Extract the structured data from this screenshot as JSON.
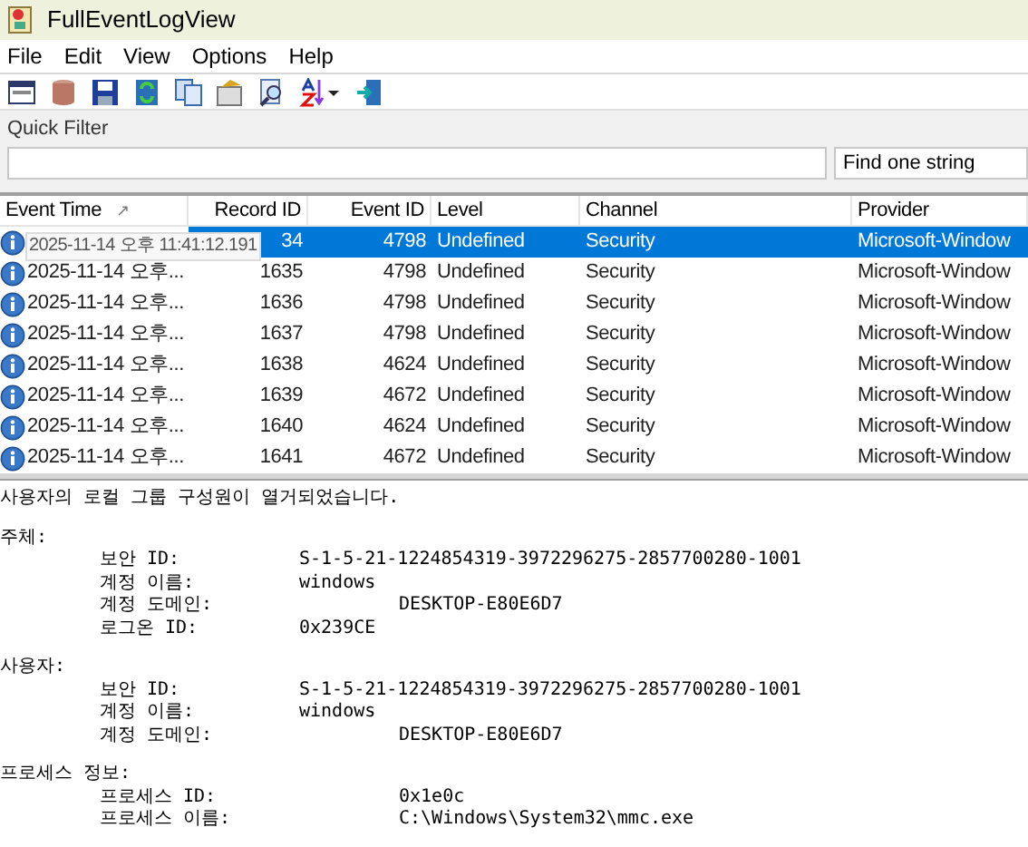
{
  "window": {
    "title": "FullEventLogView"
  },
  "menu": [
    "File",
    "Edit",
    "View",
    "Options",
    "Help"
  ],
  "quick_filter": {
    "label": "Quick Filter",
    "mode": "Find one string"
  },
  "table": {
    "columns": [
      {
        "label": "Event Time",
        "sort": "↗"
      },
      {
        "label": "Record ID"
      },
      {
        "label": "Event ID"
      },
      {
        "label": "Level"
      },
      {
        "label": "Channel"
      },
      {
        "label": "Provider"
      }
    ],
    "rows": [
      {
        "selected": true,
        "record_id": "34",
        "event_id": "4798",
        "level": "Undefined",
        "channel": "Security",
        "provider": "Microsoft-Window"
      },
      {
        "selected": false,
        "event_time": "2025-11-14 오후...",
        "record_id": "1635",
        "event_id": "4798",
        "level": "Undefined",
        "channel": "Security",
        "provider": "Microsoft-Window"
      },
      {
        "selected": false,
        "event_time": "2025-11-14 오후...",
        "record_id": "1636",
        "event_id": "4798",
        "level": "Undefined",
        "channel": "Security",
        "provider": "Microsoft-Window"
      },
      {
        "selected": false,
        "event_time": "2025-11-14 오후...",
        "record_id": "1637",
        "event_id": "4798",
        "level": "Undefined",
        "channel": "Security",
        "provider": "Microsoft-Window"
      },
      {
        "selected": false,
        "event_time": "2025-11-14 오후...",
        "record_id": "1638",
        "event_id": "4624",
        "level": "Undefined",
        "channel": "Security",
        "provider": "Microsoft-Window"
      },
      {
        "selected": false,
        "event_time": "2025-11-14 오후...",
        "record_id": "1639",
        "event_id": "4672",
        "level": "Undefined",
        "channel": "Security",
        "provider": "Microsoft-Window"
      },
      {
        "selected": false,
        "event_time": "2025-11-14 오후...",
        "record_id": "1640",
        "event_id": "4624",
        "level": "Undefined",
        "channel": "Security",
        "provider": "Microsoft-Window"
      },
      {
        "selected": false,
        "event_time": "2025-11-14 오후...",
        "record_id": "1641",
        "event_id": "4672",
        "level": "Undefined",
        "channel": "Security",
        "provider": "Microsoft-Window"
      }
    ]
  },
  "tooltip": "2025-11-14 오후 11:41:12.191",
  "details": {
    "summary": "사용자의 로컬 그룹 구성원이 열거되었습니다.",
    "sections": [
      {
        "heading": "주체:",
        "fields": [
          {
            "label": "보안 ID:",
            "value": "S-1-5-21-1224854319-3972296275-2857700280-1001",
            "kind": "near"
          },
          {
            "label": "계정 이름:",
            "value": "windows",
            "kind": "near"
          },
          {
            "label": "계정 도메인:",
            "value": "DESKTOP-E80E6D7",
            "kind": "far"
          },
          {
            "label": "로그온 ID:",
            "value": "0x239CE",
            "kind": "near"
          }
        ]
      },
      {
        "heading": "사용자:",
        "fields": [
          {
            "label": "보안 ID:",
            "value": "S-1-5-21-1224854319-3972296275-2857700280-1001",
            "kind": "near"
          },
          {
            "label": "계정 이름:",
            "value": "windows",
            "kind": "near"
          },
          {
            "label": "계정 도메인:",
            "value": "DESKTOP-E80E6D7",
            "kind": "far"
          }
        ]
      },
      {
        "heading": "프로세스 정보:",
        "fields": [
          {
            "label": "프로세스 ID:",
            "value": "0x1e0c",
            "kind": "far"
          },
          {
            "label": "프로세스 이름:",
            "value": "C:\\Windows\\System32\\mmc.exe",
            "kind": "far"
          }
        ]
      }
    ]
  }
}
